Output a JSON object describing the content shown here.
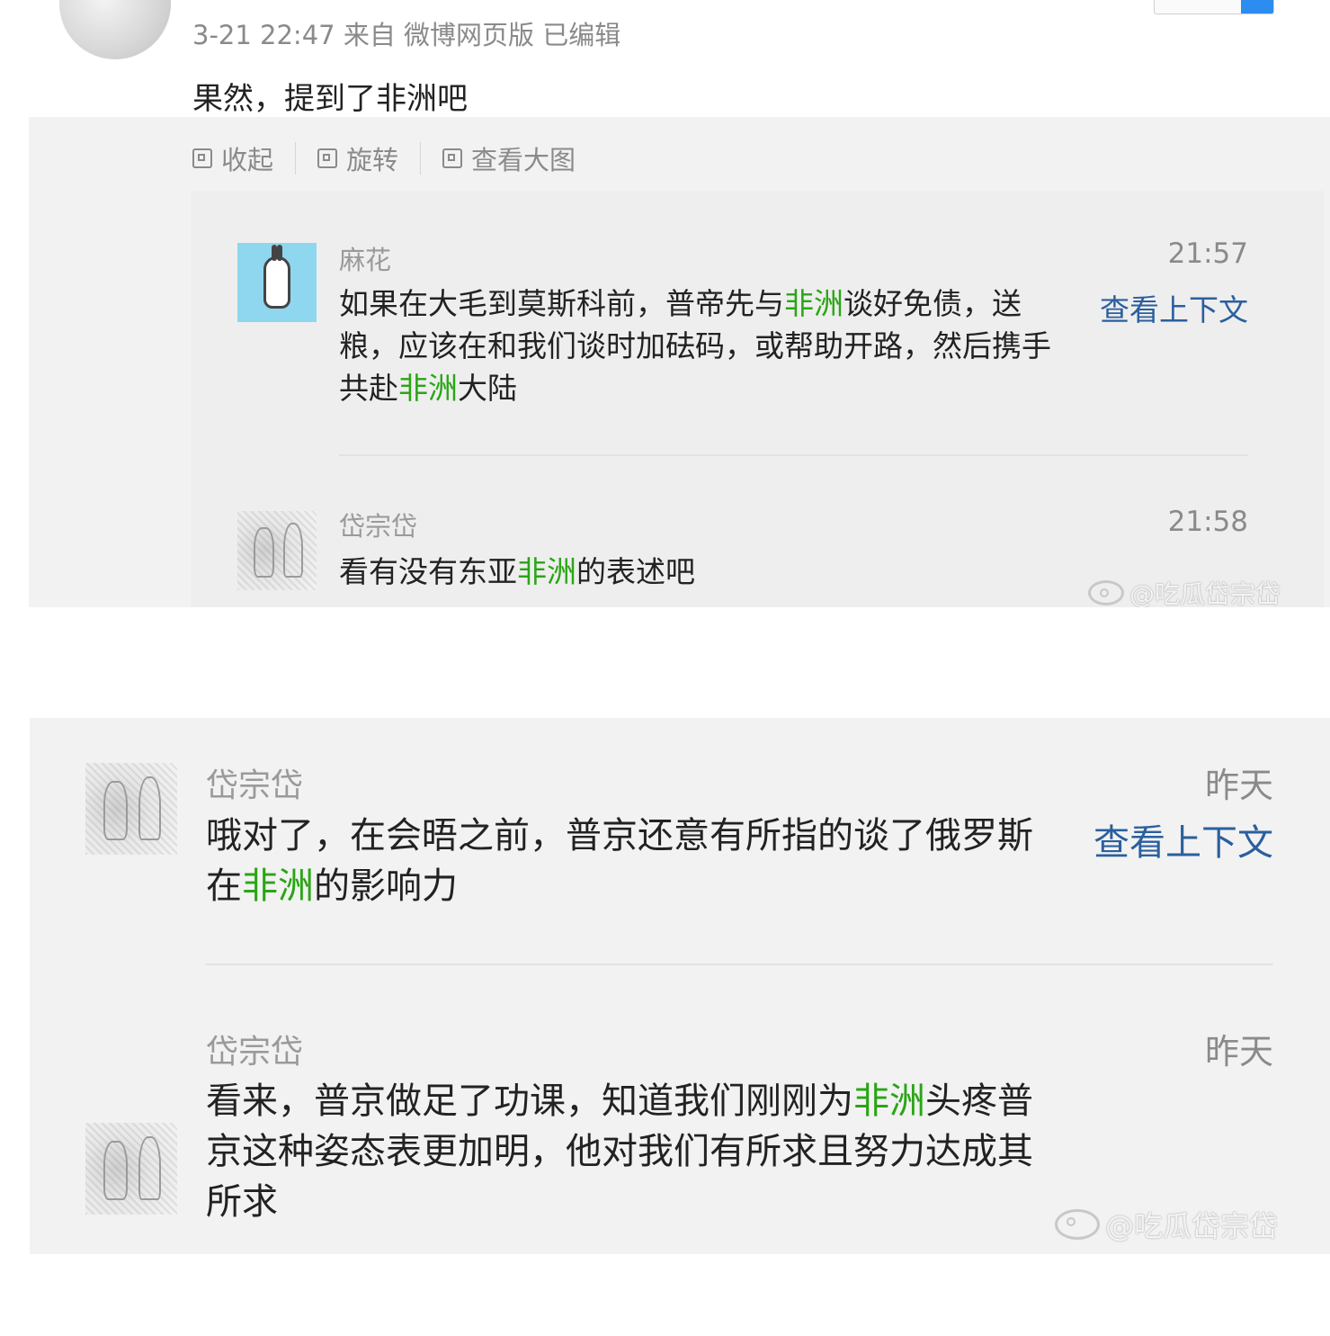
{
  "post": {
    "meta": "3-21 22:47 来自 微博网页版 已编辑",
    "text": "果然，提到了非洲吧"
  },
  "toolbar": {
    "collapse_label": "收起",
    "rotate_label": "旋转",
    "view_large_label": "查看大图"
  },
  "panel1_comments": [
    {
      "name": "麻花",
      "time": "21:57",
      "text_parts": [
        "如果在大毛到莫斯科前，普帝先与",
        "非洲",
        "谈好免债，送粮，应该在和我们谈时加砝码，或帮助开路，然后携手共赴",
        "非洲",
        "大陆"
      ],
      "context_link": "查看上下文"
    },
    {
      "name": "岱宗岱",
      "time": "21:58",
      "text_parts": [
        "看有没有东亚",
        "非洲",
        "的表述吧"
      ]
    }
  ],
  "panel2_comments": [
    {
      "name": "岱宗岱",
      "time": "昨天",
      "text_parts": [
        "哦对了，在会晤之前，普京还意有所指的谈了俄罗斯在",
        "非洲",
        "的影响力"
      ],
      "context_link": "查看上下文"
    },
    {
      "name": "岱宗岱",
      "time": "昨天",
      "text_parts": [
        "看来，普京做足了功课，知道我们刚刚为",
        "非洲",
        "头疼普京这种姿态表更加明，他对我们有所求且努力达成其所求"
      ]
    }
  ],
  "watermark": "@吃瓜岱宗岱",
  "colors": {
    "highlight": "#2aa515",
    "link": "#2b5f9e",
    "panel_bg": "#f2f2f2",
    "meta_gray": "#8a8a8a"
  },
  "icons": [
    "collapse-icon",
    "rotate-icon",
    "view-large-icon",
    "weibo-logo-icon"
  ]
}
